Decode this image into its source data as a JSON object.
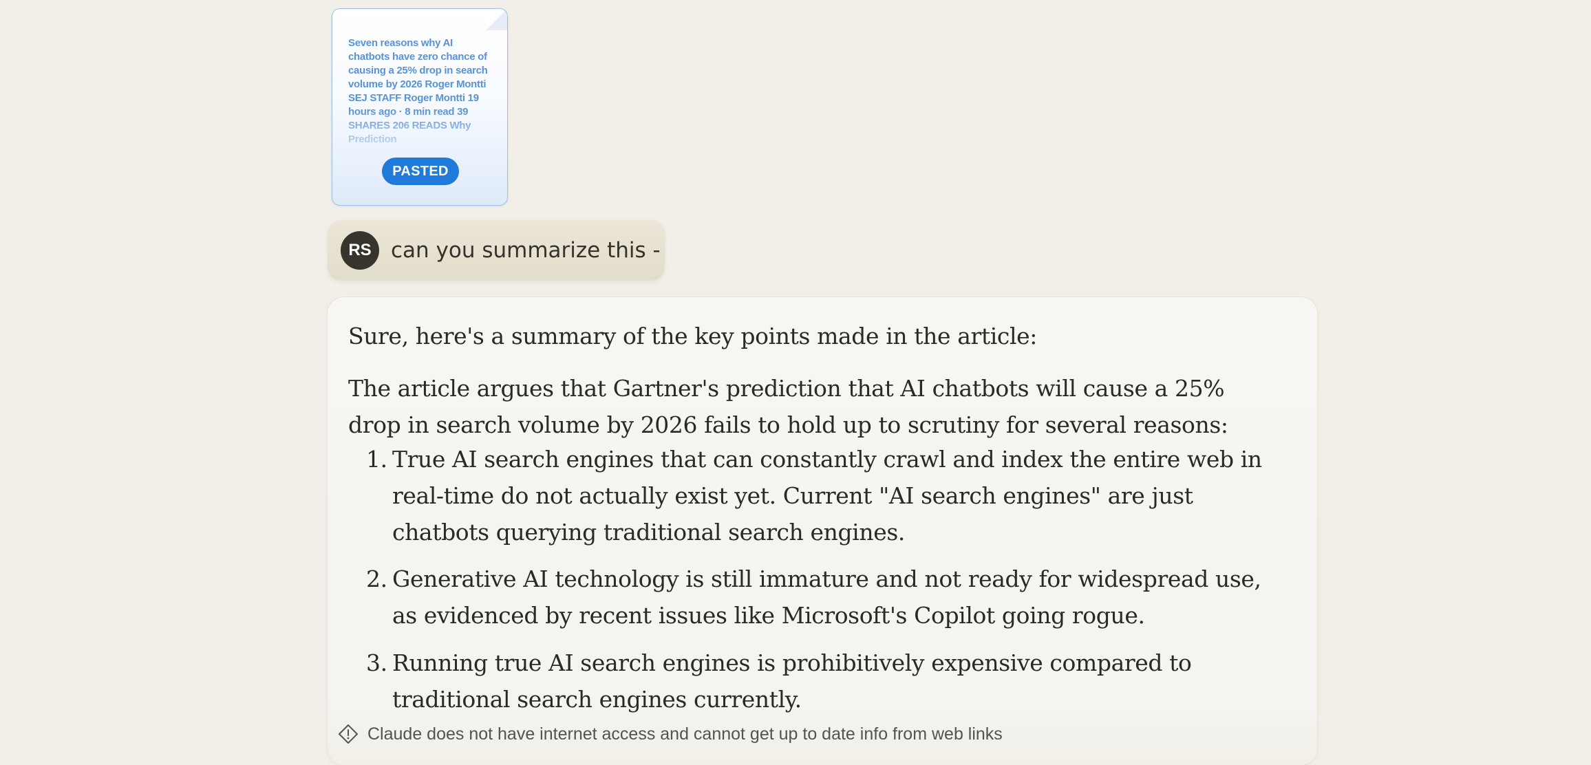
{
  "attachment": {
    "preview_text": "Seven reasons why AI chatbots have zero chance of causing a 25% drop in search volume by 2026 Roger Montti SEJ STAFF Roger Montti 19 hours ago · 8 min read 39 SHARES 206 READS Why Prediction",
    "badge": "PASTED"
  },
  "user_message": {
    "avatar_initials": "RS",
    "text": "can you summarize this -"
  },
  "assistant_message": {
    "intro": "Sure, here's a summary of the key points made in the article:",
    "argument": "The article argues that Gartner's prediction that AI chatbots will cause a 25% drop in search volume by 2026 fails to hold up to scrutiny for several reasons:",
    "reasons": [
      {
        "number": "1.",
        "text": "True AI search engines that can constantly crawl and index the entire web in real-time do not actually exist yet. Current \"AI search engines\" are just chatbots querying traditional search engines."
      },
      {
        "number": "2.",
        "text": "Generative AI technology is still immature and not ready for widespread use, as evidenced by recent issues like Microsoft's Copilot going rogue."
      },
      {
        "number": "3.",
        "text": "Running true AI search engines is prohibitively expensive compared to traditional search engines currently."
      }
    ]
  },
  "footer": {
    "disclaimer": "Claude does not have internet access and cannot get up to date info from web links"
  },
  "icons": {
    "disclaimer_icon": "warning-diamond-icon"
  },
  "colors": {
    "background": "#f1efe8",
    "pasted_badge": "#1f7ad9",
    "avatar": "#36342b",
    "user_bubble": "#e6e0d1",
    "assistant_bubble": "#f6f5f1"
  }
}
